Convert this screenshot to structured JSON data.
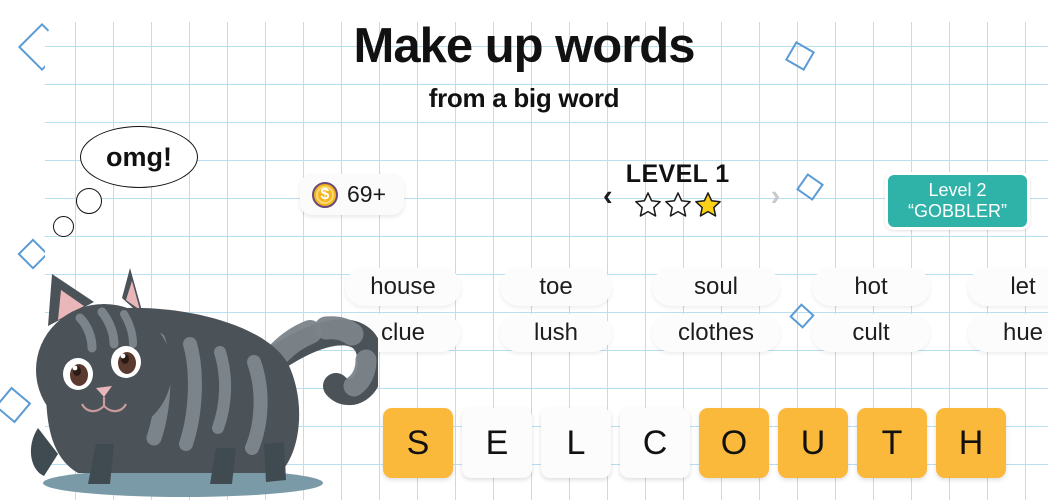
{
  "header": {
    "title": "Make up words",
    "subtitle": "from a big word"
  },
  "hud": {
    "coin_icon": "coin-icon",
    "coin_symbol": "$",
    "coin_count": "69+",
    "prev_arrow": "‹",
    "next_arrow": "›",
    "level_label": "LEVEL 1",
    "stars_total": 3,
    "stars_filled": 1,
    "star_filled_color": "#fcd116",
    "star_empty_color": "#ffffff"
  },
  "level_badge": {
    "line1": "Level 2",
    "line2": "“GOBBLER”",
    "color": "#2fb3a8"
  },
  "words": {
    "row1": [
      "house",
      "toe",
      "soul",
      "hot",
      "let"
    ],
    "row2": [
      "clue",
      "lush",
      "clothes",
      "cult",
      "hue"
    ]
  },
  "tiles": [
    {
      "letter": "S",
      "state": "amber"
    },
    {
      "letter": "E",
      "state": "white"
    },
    {
      "letter": "L",
      "state": "white"
    },
    {
      "letter": "C",
      "state": "white"
    },
    {
      "letter": "O",
      "state": "amber"
    },
    {
      "letter": "U",
      "state": "amber"
    },
    {
      "letter": "T",
      "state": "amber"
    },
    {
      "letter": "H",
      "state": "amber"
    }
  ],
  "mascot": {
    "bubble_text": "omg!",
    "name": "cat-mascot",
    "body_color": "#4b5359",
    "stripe_color": "#7b848a",
    "ear_color": "#e9b7b9",
    "shadow_color": "#7b9aa8"
  },
  "decor": {
    "diamond_color": "#5b9bd5",
    "grid_color": "#b9dff2",
    "phone_color": "#333333",
    "tile_amber": "#fbb93b"
  }
}
